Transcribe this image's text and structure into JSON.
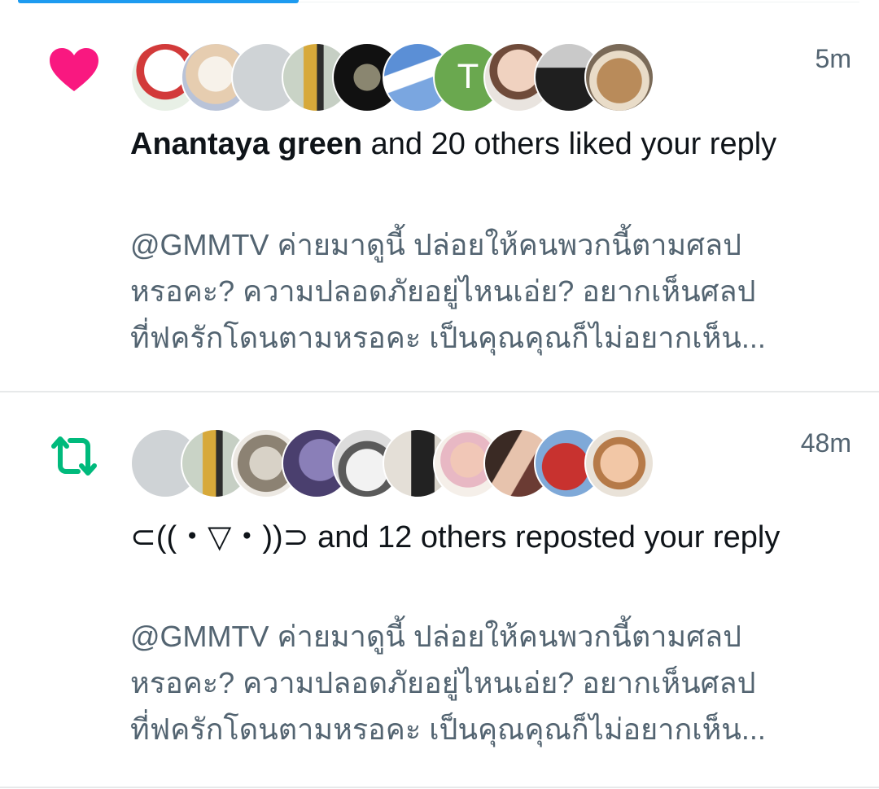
{
  "notifications": [
    {
      "type": "like",
      "icon": "heart-icon",
      "icon_color": "#f91880",
      "time": "5m",
      "actor": "Anantaya green",
      "action": " and 20 others liked your reply",
      "preview": "@GMMTV  ค่ายมาดูนี้  ปล่อยให้คนพวกนี้ตามศลป\nหรอคะ? ความปลอดภัยอยู่ไหนเอ่ย?  อยากเห็นศลป\nที่ฟครักโดนตามหรอคะ เป็นคุณคุณก็ไม่อยากเห็น...",
      "avatars": [
        {
          "name": "white bear avatar",
          "letter": ""
        },
        {
          "name": "cat avatar",
          "letter": ""
        },
        {
          "name": "default gray avatar",
          "letter": ""
        },
        {
          "name": "woman avatar",
          "letter": ""
        },
        {
          "name": "moon avatar",
          "letter": ""
        },
        {
          "name": "sky avatar",
          "letter": ""
        },
        {
          "name": "letter T avatar",
          "letter": "T"
        },
        {
          "name": "man avatar",
          "letter": ""
        },
        {
          "name": "man in suit avatar",
          "letter": ""
        },
        {
          "name": "dog avatar",
          "letter": ""
        }
      ]
    },
    {
      "type": "repost",
      "icon": "repost-icon",
      "icon_color": "#00ba7c",
      "time": "48m",
      "actor": "⊂((・▽・))⊃",
      "action": " and 12 others reposted your reply",
      "preview": "@GMMTV  ค่ายมาดูนี้  ปล่อยให้คนพวกนี้ตามศลป\nหรอคะ? ความปลอดภัยอยู่ไหนเอ่ย?  อยากเห็นศลป\nที่ฟครักโดนตามหรอคะ เป็นคุณคุณก็ไม่อยากเห็น...",
      "avatars": [
        {
          "name": "default gray avatar",
          "letter": ""
        },
        {
          "name": "woman avatar",
          "letter": ""
        },
        {
          "name": "cat avatar",
          "letter": ""
        },
        {
          "name": "purple bird avatar",
          "letter": ""
        },
        {
          "name": "cat on blanket avatar",
          "letter": ""
        },
        {
          "name": "man avatar",
          "letter": ""
        },
        {
          "name": "girl avatar",
          "letter": ""
        },
        {
          "name": "couple avatar",
          "letter": ""
        },
        {
          "name": "red object avatar",
          "letter": ""
        },
        {
          "name": "smiling child avatar",
          "letter": ""
        }
      ]
    }
  ]
}
